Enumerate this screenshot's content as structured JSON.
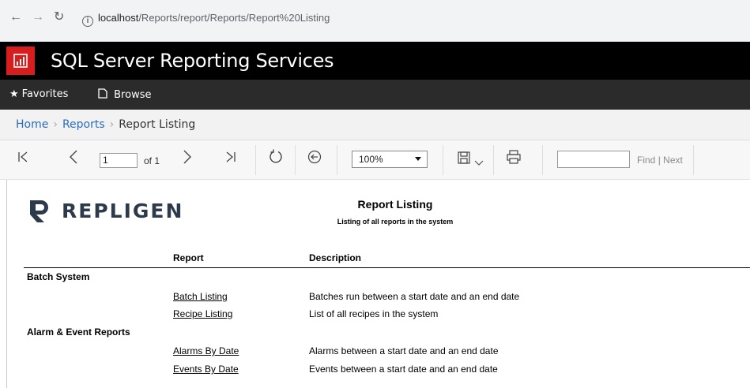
{
  "browser": {
    "url_host": "localhost",
    "url_path": "/Reports/report/Reports/Report%20Listing"
  },
  "app": {
    "title": "SQL Server Reporting Services",
    "brand_color": "#d71e1e"
  },
  "menu": {
    "favorites": "Favorites",
    "browse": "Browse"
  },
  "breadcrumb": {
    "home": "Home",
    "reports": "Reports",
    "current": "Report Listing"
  },
  "toolbar": {
    "page_value": "1",
    "of_label": "of 1",
    "zoom_value": "100%",
    "find_placeholder": "",
    "find_label": "Find",
    "next_label": "Next",
    "find_sep": "|"
  },
  "report": {
    "logo_text": "REPLIGEN",
    "title": "Report Listing",
    "subtitle": "Listing of all reports in the system",
    "columns": {
      "report": "Report",
      "description": "Description"
    },
    "categories": [
      {
        "name": "Batch System",
        "items": [
          {
            "name": "Batch Listing",
            "description": "Batches run between a start date and an end date"
          },
          {
            "name": "Recipe Listing",
            "description": "List of all recipes in the system"
          }
        ]
      },
      {
        "name": "Alarm & Event Reports",
        "items": [
          {
            "name": "Alarms By Date",
            "description": "Alarms between a start date and an end date"
          },
          {
            "name": "Events By Date",
            "description": "Events between a start date and an end date"
          }
        ]
      }
    ]
  }
}
